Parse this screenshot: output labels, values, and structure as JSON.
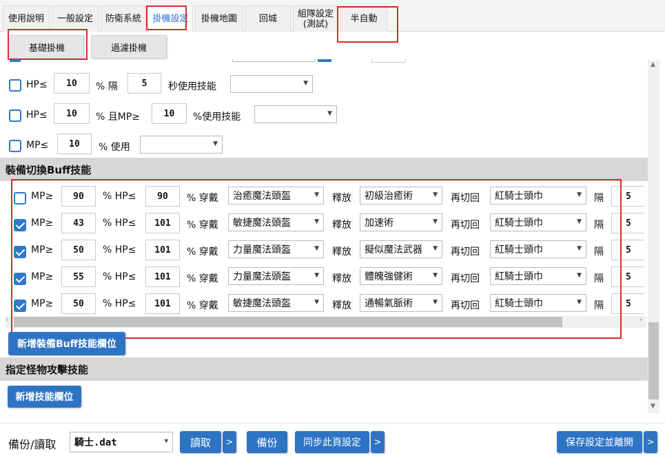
{
  "tabs": [
    {
      "label": "使用說明"
    },
    {
      "label": "一般設定"
    },
    {
      "label": "防衛系統"
    },
    {
      "label": "掛機設定"
    },
    {
      "label": "掛機地圖"
    },
    {
      "label": "回城"
    },
    {
      "label": "組隊設定",
      "label2": "(測試)"
    },
    {
      "label": "半自動"
    }
  ],
  "subtabs": [
    {
      "label": "基礎掛機"
    },
    {
      "label": "過濾掛機"
    }
  ],
  "hp_rows": [
    {
      "a": "HP≤",
      "v1": "10",
      "b": "% 隔",
      "v2": "5",
      "c": "秒使用技能"
    },
    {
      "a": "HP≤",
      "v1": "10",
      "b": "% 且MP≥",
      "v2": "10",
      "c": "%使用技能"
    },
    {
      "a": "MP≤",
      "v1": "10",
      "b": "% 使用"
    }
  ],
  "equip_section": {
    "title": "裝備切換Buff技能",
    "add_label": "新增裝備Buff技能欄位"
  },
  "buff_labels": {
    "mp": "MP≥",
    "hp": "% HP≤",
    "wear": "% 穿戴",
    "release": "釋放",
    "back": "再切回",
    "interval": "隔"
  },
  "buff_rows": [
    {
      "checked": false,
      "mp": "90",
      "hp": "90",
      "wear": "治癒魔法頭盔",
      "skill": "初級治癒術",
      "back": "紅騎士頭巾",
      "gap": "5"
    },
    {
      "checked": true,
      "mp": "43",
      "hp": "101",
      "wear": "敏捷魔法頭盔",
      "skill": "加速術",
      "back": "紅騎士頭巾",
      "gap": "5"
    },
    {
      "checked": true,
      "mp": "50",
      "hp": "101",
      "wear": "力量魔法頭盔",
      "skill": "擬似魔法武器",
      "back": "紅騎士頭巾",
      "gap": "5"
    },
    {
      "checked": true,
      "mp": "55",
      "hp": "101",
      "wear": "力量魔法頭盔",
      "skill": "體魄強健術",
      "back": "紅騎士頭巾",
      "gap": "5"
    },
    {
      "checked": true,
      "mp": "50",
      "hp": "101",
      "wear": "敏捷魔法頭盔",
      "skill": "通暢氣脈術",
      "back": "紅騎士頭巾",
      "gap": "5"
    }
  ],
  "monster_section": {
    "title": "指定怪物攻擊技能",
    "add_label": "新增技能欄位"
  },
  "bottom": {
    "backup_label": "備份/讀取",
    "file": "騎士.dat",
    "read": "讀取",
    "arrow": ">",
    "backup": "備份",
    "sync": "同步此頁設定",
    "save": "保存設定並離開"
  },
  "colors": {
    "accent": "#2e74c4",
    "highlight": "#e0262f",
    "section_bg": "#d7d7d7"
  }
}
